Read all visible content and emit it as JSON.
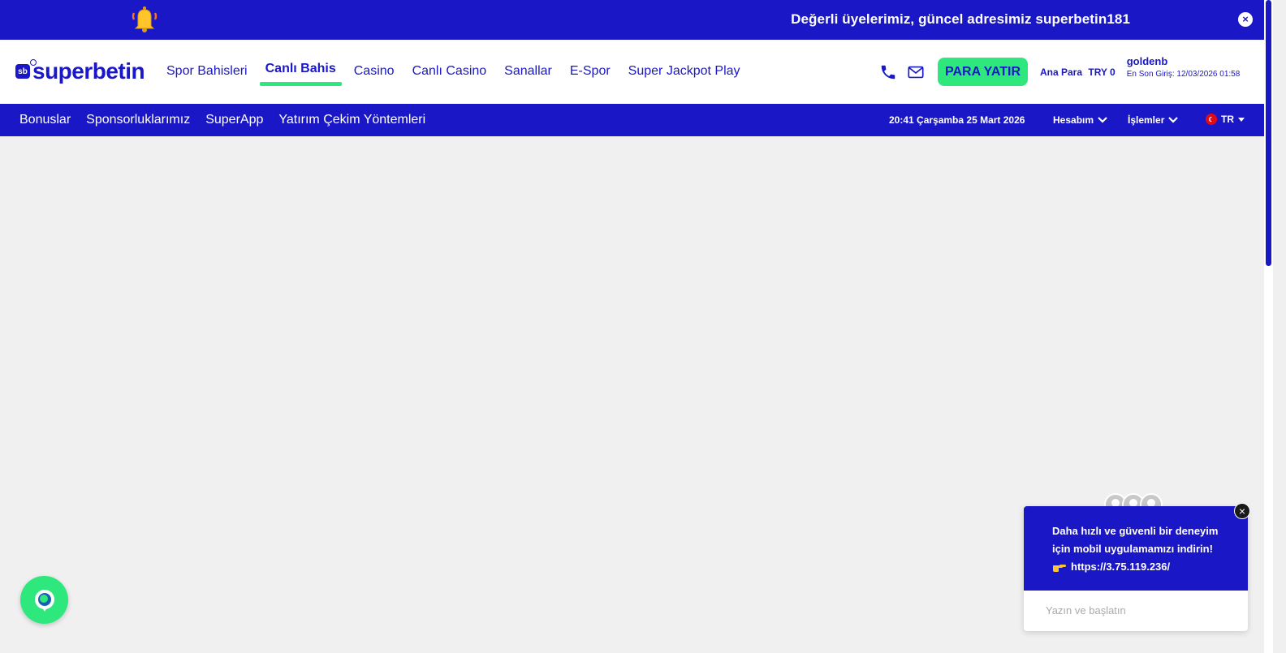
{
  "announcement": {
    "message": "Değerli üyelerimiz, güncel adresimiz superbetin181",
    "close_label": "×"
  },
  "header": {
    "logo_badge": "sb",
    "logo_text": "superbetin",
    "nav": [
      {
        "label": "Spor Bahisleri"
      },
      {
        "label": "Canlı Bahis"
      },
      {
        "label": "Casino"
      },
      {
        "label": "Canlı Casino"
      },
      {
        "label": "Sanallar"
      },
      {
        "label": "E-Spor"
      },
      {
        "label": "Super Jackpot Play"
      }
    ],
    "deposit_label": "PARA YATIR",
    "balance_label": "Ana Para",
    "balance_amount": "TRY 0",
    "username": "goldenb",
    "last_login": "En Son Giriş: 12/03/2026 01:58"
  },
  "subnav": {
    "links": [
      {
        "label": "Bonuslar"
      },
      {
        "label": "Sponsorluklarımız"
      },
      {
        "label": "SuperApp"
      },
      {
        "label": "Yatırım Çekim Yöntemleri"
      }
    ],
    "datetime": "20:41 Çarşamba 25 Mart 2026",
    "account_label": "Hesabım",
    "operations_label": "İşlemler",
    "language": "TR"
  },
  "chat_popup": {
    "line1": "Daha hızlı ve güvenli bir deneyim",
    "line2": "için mobil uygulamamızı indirin!",
    "link": "https://3.75.119.236/",
    "input_placeholder": "Yazın ve başlatın",
    "close_label": "×"
  },
  "colors": {
    "brand": "#1a17c6",
    "accent": "#2ee87e",
    "background": "#f0f0f0"
  }
}
